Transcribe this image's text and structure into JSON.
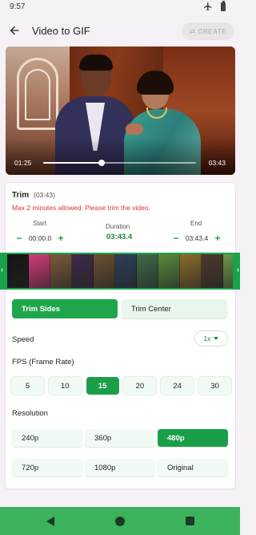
{
  "status": {
    "time": "9:57"
  },
  "appbar": {
    "title": "Video to GIF",
    "create_label": "CREATE"
  },
  "player": {
    "current_time": "01:25",
    "end_time": "03:43",
    "progress": 0.38
  },
  "trim": {
    "title": "Trim",
    "duration_paren": "(03:43)",
    "warning": "Max 2 minutes allowed. Please trim the video.",
    "start_label": "Start",
    "start_value": "00:00.0",
    "duration_label": "Duration",
    "duration_value": "03:43.4",
    "end_label": "End",
    "end_value": "03:43.4",
    "minus": "−",
    "plus": "+"
  },
  "filmstrip_colors": [
    "#151515",
    "#d23b7a",
    "#7c5a3c",
    "#3e2a4a",
    "#6a5030",
    "#2d3f5a",
    "#3f6b4a",
    "#5a8a3c",
    "#8c6b2a",
    "#4a3a2a",
    "#6b9a4a",
    "#3a5a8a"
  ],
  "modes": {
    "trim_sides": "Trim Sides",
    "trim_center": "Trim Center"
  },
  "speed": {
    "label": "Speed",
    "value": "1x"
  },
  "fps": {
    "label": "FPS (Frame Rate)",
    "options": [
      "5",
      "10",
      "15",
      "20",
      "24",
      "30"
    ],
    "selected": "15"
  },
  "resolution": {
    "label": "Resolution",
    "options": [
      "240p",
      "360p",
      "480p",
      "720p",
      "1080p",
      "Original"
    ],
    "selected": "480p"
  },
  "colors": {
    "accent": "#1fa64b",
    "warning": "#e0322a",
    "navbar": "#3db25c"
  }
}
